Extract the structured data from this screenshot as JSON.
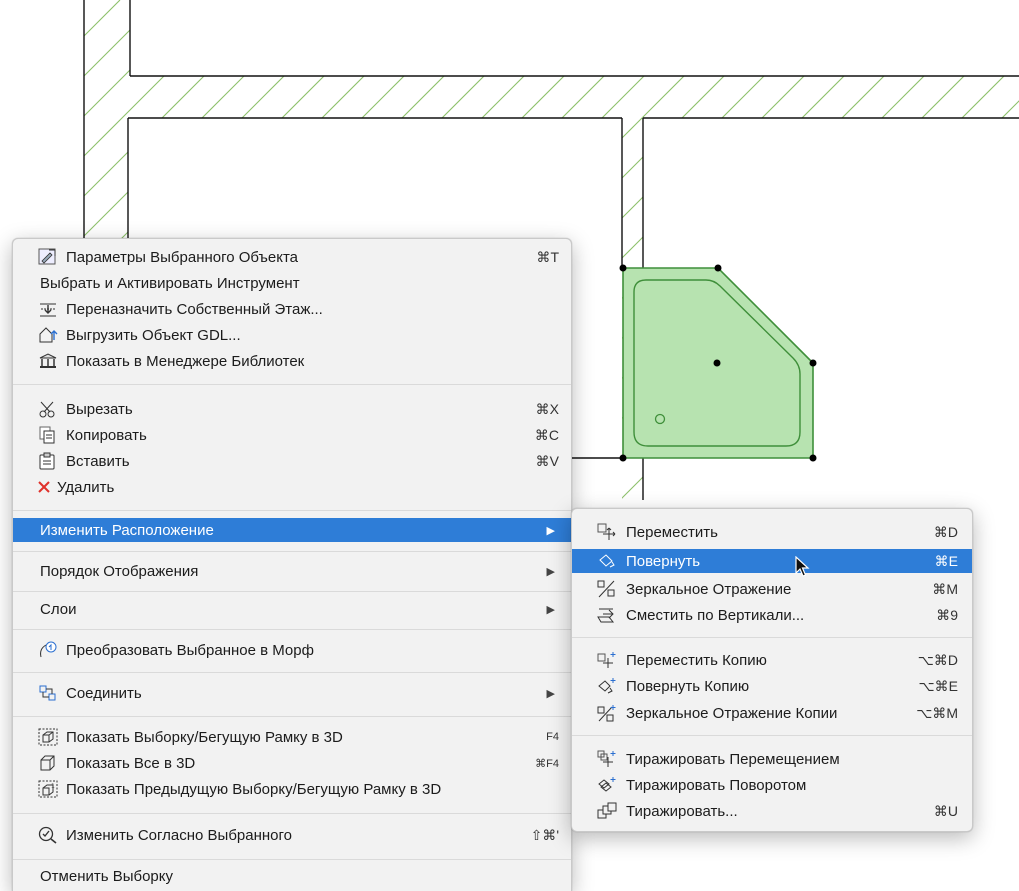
{
  "main_menu": {
    "items": [
      {
        "label": "Параметры Выбранного Объекта",
        "shortcut": "⌘T",
        "icon": "object-settings-icon"
      },
      {
        "label": "Выбрать и Активировать Инструмент"
      },
      {
        "label": "Переназначить Собственный Этаж...",
        "icon": "relink-story-icon"
      },
      {
        "label": "Выгрузить Объект GDL...",
        "icon": "save-gdl-icon"
      },
      {
        "label": "Показать в Менеджере Библиотек",
        "icon": "library-manager-icon"
      },
      {
        "label": "Вырезать",
        "shortcut": "⌘X",
        "icon": "scissors-icon"
      },
      {
        "label": "Копировать",
        "shortcut": "⌘C",
        "icon": "copy-icon"
      },
      {
        "label": "Вставить",
        "shortcut": "⌘V",
        "icon": "paste-icon"
      },
      {
        "label": "Удалить",
        "icon": "delete-x-icon"
      },
      {
        "label": "Изменить Расположение",
        "submenu": true,
        "highlighted": true
      },
      {
        "label": "Порядок Отображения",
        "submenu": true
      },
      {
        "label": "Слои",
        "submenu": true
      },
      {
        "label": "Преобразовать Выбранное в Морф",
        "icon": "morph-icon"
      },
      {
        "label": "Соединить",
        "submenu": true,
        "icon": "connect-icon"
      },
      {
        "label": "Показать Выборку/Бегущую Рамку в 3D",
        "shortcut": "F4",
        "icon": "show-selection-3d-icon"
      },
      {
        "label": "Показать Все в 3D",
        "shortcut": "⌘F4",
        "icon": "show-all-3d-icon"
      },
      {
        "label": "Показать Предыдущую Выборку/Бегущую Рамку в 3D",
        "icon": "show-previous-3d-icon"
      },
      {
        "label": "Изменить Согласно Выбранного",
        "shortcut": "⇧⌘'",
        "icon": "match-icon"
      },
      {
        "label": "Отменить Выборку"
      }
    ]
  },
  "sub_menu": {
    "items": [
      {
        "label": "Переместить",
        "shortcut": "⌘D",
        "icon": "drag-icon"
      },
      {
        "label": "Повернуть",
        "shortcut": "⌘E",
        "icon": "rotate-icon",
        "highlighted": true
      },
      {
        "label": "Зеркальное Отражение",
        "shortcut": "⌘M",
        "icon": "mirror-icon"
      },
      {
        "label": "Сместить по Вертикали...",
        "shortcut": "⌘9",
        "icon": "elevate-icon"
      },
      {
        "label": "Переместить Копию",
        "shortcut": "⌥⌘D",
        "icon": "drag-copy-icon"
      },
      {
        "label": "Повернуть Копию",
        "shortcut": "⌥⌘E",
        "icon": "rotate-copy-icon"
      },
      {
        "label": "Зеркальное Отражение Копии",
        "shortcut": "⌥⌘M",
        "icon": "mirror-copy-icon"
      },
      {
        "label": "Тиражировать Перемещением",
        "icon": "multiply-drag-icon"
      },
      {
        "label": "Тиражировать Поворотом",
        "icon": "multiply-rotate-icon"
      },
      {
        "label": "Тиражировать...",
        "shortcut": "⌘U",
        "icon": "multiply-icon"
      }
    ]
  },
  "colors": {
    "highlight": "#2e7dd7",
    "hatch": "#8cc06a",
    "object_fill": "#b7e3b0",
    "object_stroke": "#3f8f3a",
    "delete_icon": "#e0312b"
  }
}
